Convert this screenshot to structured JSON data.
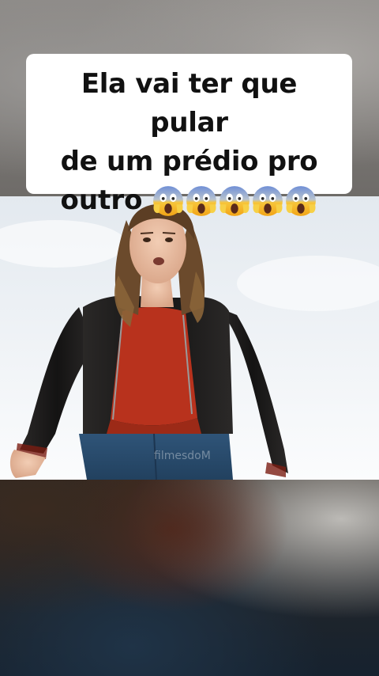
{
  "caption": {
    "line1": "Ela vai ter que pular",
    "line2": "de um prédio pro",
    "line3_text": "outro",
    "emoji_icon": "face-screaming-in-fear-icon",
    "emoji_count": 5
  },
  "video": {
    "watermark": "filmesdoM",
    "scene": "woman-in-leather-jacket-on-rooftop"
  },
  "colors": {
    "caption_bg": "#ffffff",
    "caption_text": "#111111",
    "jacket": "#1c1b1a",
    "sweater": "#b8321d",
    "jeans": "#2c4f73",
    "hair": "#6b4a2c",
    "sky": "#eef2f5"
  }
}
